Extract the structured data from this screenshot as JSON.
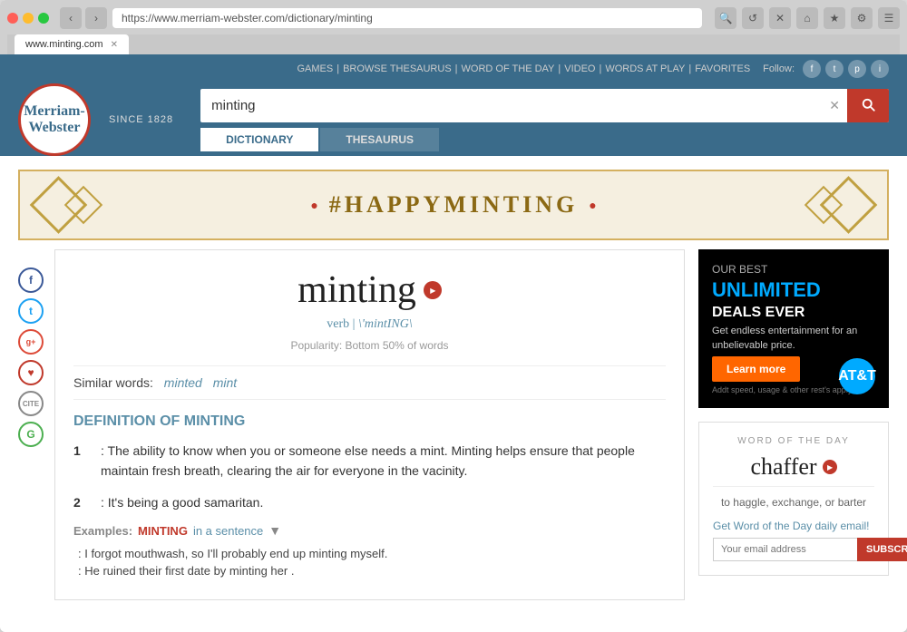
{
  "browser": {
    "url": "https://www.merriam-webster.com/dictionary/minting",
    "tab_label": "www.minting.com",
    "nav": {
      "back": "‹",
      "forward": "›",
      "refresh": "↺",
      "close": "✕"
    }
  },
  "header": {
    "logo_line1": "Merriam-",
    "logo_line2": "Webster",
    "since": "SINCE 1828",
    "search_value": "minting",
    "top_nav": [
      "GAMES",
      "BROWSE THESAURUS",
      "WORD OF THE DAY",
      "VIDEO",
      "WORDS AT PLAY",
      "FAVORITES"
    ],
    "follow_label": "Follow:",
    "tabs": [
      {
        "label": "DICTIONARY",
        "active": true
      },
      {
        "label": "THESAURUS",
        "active": false
      }
    ]
  },
  "ad_banner": {
    "text": "#HAPPYMINTING"
  },
  "social_buttons": [
    {
      "id": "fb",
      "label": "f"
    },
    {
      "id": "tw",
      "label": "t"
    },
    {
      "id": "gp",
      "label": "g+"
    },
    {
      "id": "fav",
      "label": "♥"
    },
    {
      "id": "cite",
      "label": "CITE"
    },
    {
      "id": "grammar",
      "label": "G"
    }
  ],
  "word": {
    "title": "minting",
    "pos": "verb",
    "separator": "|",
    "pronunciation": "\\'mintING\\",
    "popularity": "Popularity: Bottom 50% of words",
    "similar_label": "Similar words:",
    "similar_words": [
      "minted",
      "mint"
    ],
    "definition_title": "Definition of",
    "definition_word": "MINTING",
    "definitions": [
      {
        "num": "1",
        "text": ": The ability to know when you or someone else needs a mint. Minting helps ensure that people maintain fresh breath, clearing the air for everyone in the vacinity."
      },
      {
        "num": "2",
        "text": ": It's being a good samaritan."
      }
    ],
    "examples_label": "Examples:",
    "examples_word": "MINTING",
    "examples_link": "in a sentence",
    "sentences": [
      ": I forgot mouthwash, so I'll probably end up minting myself.",
      ": He ruined their first date by minting her ."
    ]
  },
  "ad_box": {
    "our_best": "OUR BEST",
    "unlimited": "UNLIMITED",
    "deals": "DEALS EVER",
    "desc": "Get endless entertainment for an unbelievable price.",
    "btn_label": "Learn more",
    "footer": "Addt speed, usage & other rest's apply."
  },
  "wotd": {
    "label": "WORD OF THE DAY",
    "word": "chaffer",
    "definition": "to haggle, exchange, or barter",
    "email_prompt": "Get Word of the Day daily email!",
    "email_placeholder": "Your email address",
    "subscribe_btn": "SUBSCRIBE"
  }
}
